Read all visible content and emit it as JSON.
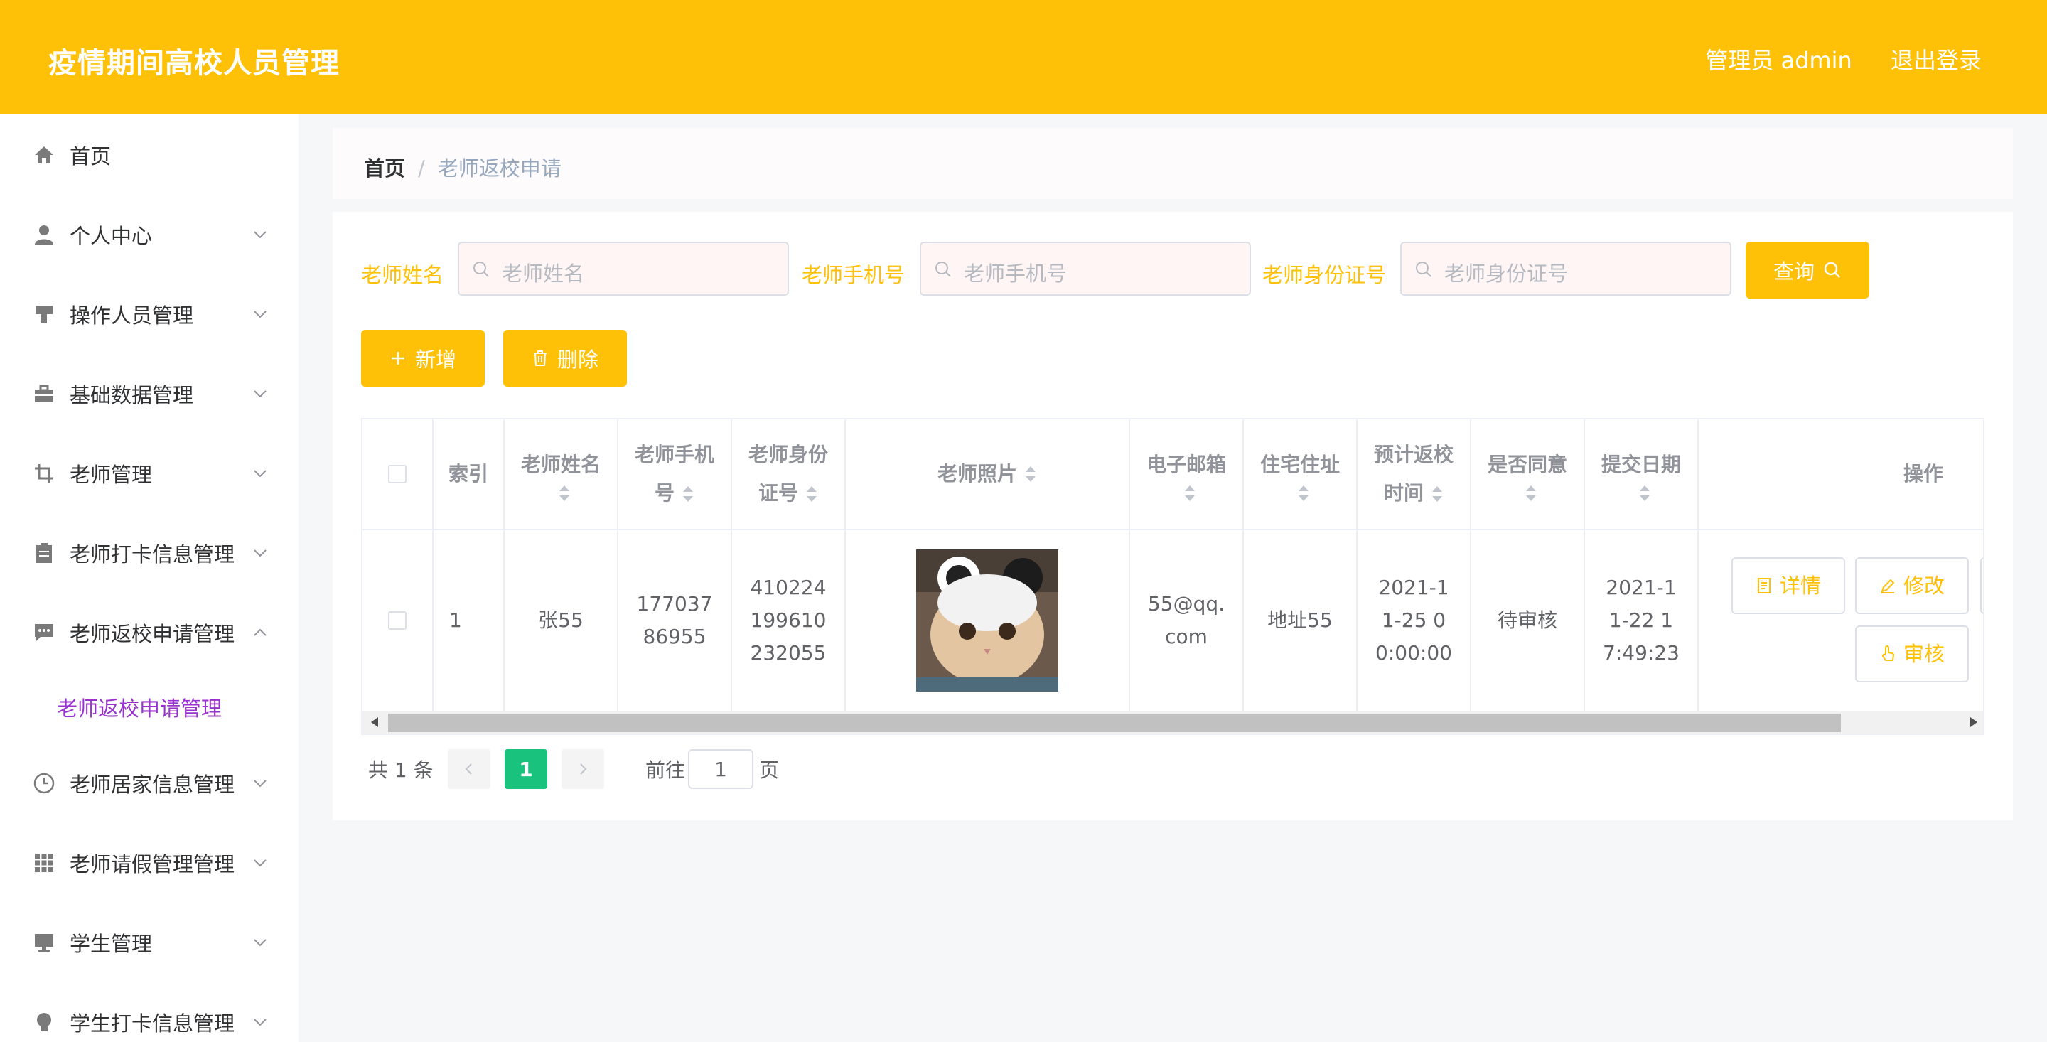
{
  "header": {
    "app_title": "疫情期间高校人员管理",
    "admin_label": "管理员 admin",
    "logout_label": "退出登录"
  },
  "sidebar": {
    "items": [
      {
        "label": "首页",
        "icon": "home-icon",
        "expanded": false
      },
      {
        "label": "个人中心",
        "icon": "user-icon",
        "expanded": false
      },
      {
        "label": "操作人员管理",
        "icon": "brush-icon",
        "expanded": false
      },
      {
        "label": "基础数据管理",
        "icon": "briefcase-icon",
        "expanded": false
      },
      {
        "label": "老师管理",
        "icon": "crop-icon",
        "expanded": false
      },
      {
        "label": "老师打卡信息管理",
        "icon": "clipboard-icon",
        "expanded": false
      },
      {
        "label": "老师返校申请管理",
        "icon": "chat-icon",
        "expanded": true
      },
      {
        "label": "老师居家信息管理",
        "icon": "clock-icon",
        "expanded": false
      },
      {
        "label": "老师请假管理管理",
        "icon": "grid-icon",
        "expanded": false
      },
      {
        "label": "学生管理",
        "icon": "monitor-icon",
        "expanded": false
      },
      {
        "label": "学生打卡信息管理",
        "icon": "bulb-icon",
        "expanded": false
      }
    ],
    "active_submenu": "老师返校申请管理"
  },
  "breadcrumb": {
    "home": "首页",
    "separator": "/",
    "current": "老师返校申请"
  },
  "search": {
    "name_label": "老师姓名",
    "name_placeholder": "老师姓名",
    "phone_label": "老师手机号",
    "phone_placeholder": "老师手机号",
    "idcard_label": "老师身份证号",
    "idcard_placeholder": "老师身份证号",
    "query_label": "查询"
  },
  "actions": {
    "add_label": "新增",
    "delete_label": "删除"
  },
  "table": {
    "headers": {
      "index": "索引",
      "name": "老师姓名",
      "phone": "老师手机号",
      "idcard": "老师身份证号",
      "photo": "老师照片",
      "email": "电子邮箱",
      "address": "住宅住址",
      "return_time": "预计返校时间",
      "agree": "是否同意",
      "submit_date": "提交日期",
      "operations": "操作"
    },
    "rows": [
      {
        "index": "1",
        "name": "张55",
        "phone": "17703786955",
        "idcard": "410224199610232055",
        "email": "55@qq.com",
        "address": "地址55",
        "return_time": "2021-11-25 00:00:00",
        "agree": "待审核",
        "submit_date": "2021-11-22 17:49:23",
        "detail_label": "详情",
        "edit_label": "修改",
        "review_label": "审核"
      }
    ]
  },
  "pagination": {
    "total": "共 1 条",
    "current_page": "1",
    "goto_label": "前往",
    "goto_value": "1",
    "page_suffix": "页"
  },
  "colors": {
    "accent": "#ffc107",
    "active_page": "#19c37d",
    "submenu_active": "#9932cc"
  }
}
